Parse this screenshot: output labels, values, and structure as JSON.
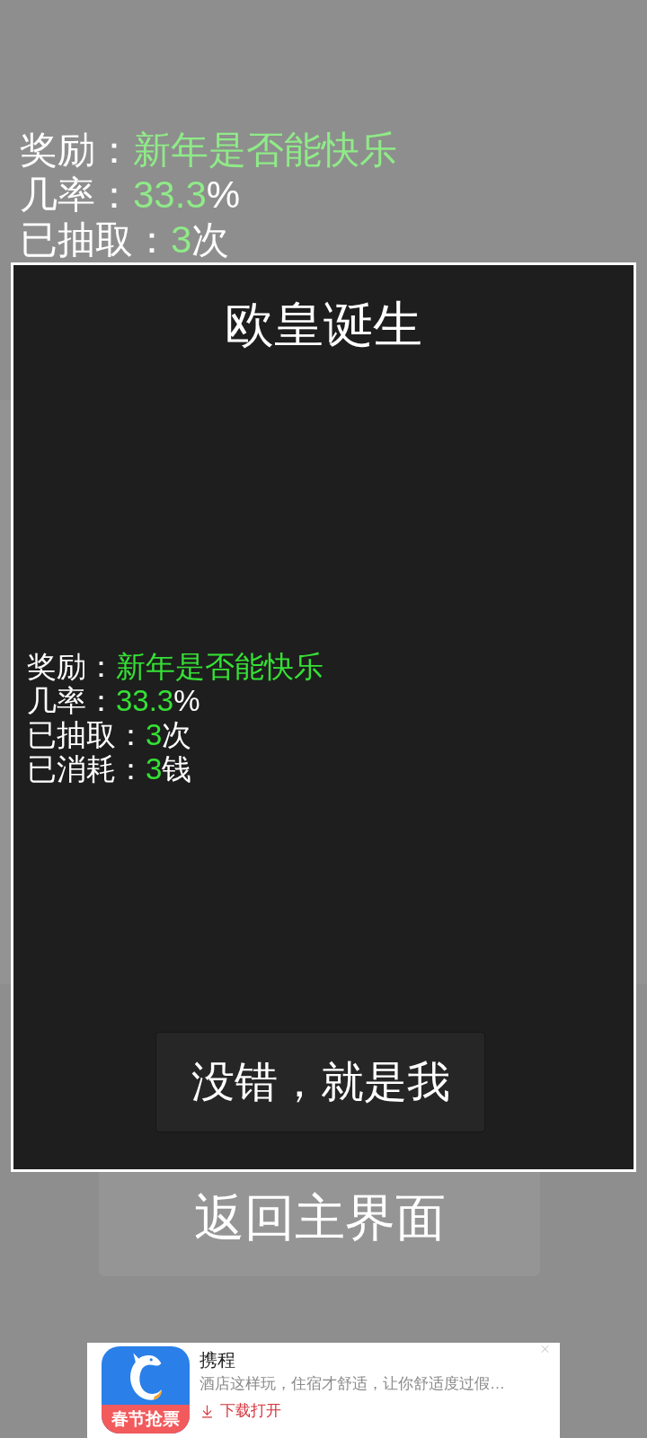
{
  "background_stats": [
    {
      "label": "奖励：",
      "value": "新年是否能快乐"
    },
    {
      "label": "几率：",
      "value": "33.3",
      "unit": "%"
    },
    {
      "label": "已抽取：",
      "value": "3",
      "unit": "次"
    }
  ],
  "dialog": {
    "title": "欧皇诞生",
    "stats": [
      {
        "label": "奖励：",
        "value": "新年是否能快乐"
      },
      {
        "label": "几率：",
        "value": "33.3",
        "unit": "%"
      },
      {
        "label": "已抽取：",
        "value": "3",
        "unit": "次"
      },
      {
        "label": "已消耗：",
        "value": "3",
        "unit": "钱"
      }
    ],
    "confirm_button": "没错，就是我"
  },
  "back_button": "返回主界面",
  "ad": {
    "app_name": "携程",
    "icon_banner": "春节抢票",
    "description": "酒店这样玩，住宿才舒适，让你舒适度过假…",
    "action": "下载打开"
  }
}
